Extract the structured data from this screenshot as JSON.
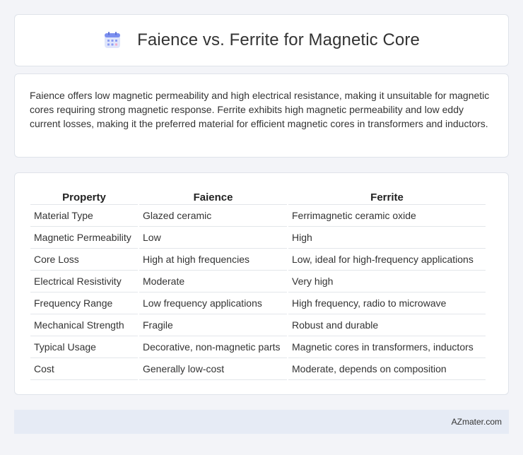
{
  "header": {
    "title": "Faience vs. Ferrite for Magnetic Core",
    "icon": "calendar-icon"
  },
  "summary": "Faience offers low magnetic permeability and high electrical resistance, making it unsuitable for magnetic cores requiring strong magnetic response. Ferrite exhibits high magnetic permeability and low eddy current losses, making it the preferred material for efficient magnetic cores in transformers and inductors.",
  "table": {
    "headers": [
      "Property",
      "Faience",
      "Ferrite"
    ],
    "rows": [
      [
        "Material Type",
        "Glazed ceramic",
        "Ferrimagnetic ceramic oxide"
      ],
      [
        "Magnetic Permeability",
        "Low",
        "High"
      ],
      [
        "Core Loss",
        "High at high frequencies",
        "Low, ideal for high-frequency applications"
      ],
      [
        "Electrical Resistivity",
        "Moderate",
        "Very high"
      ],
      [
        "Frequency Range",
        "Low frequency applications",
        "High frequency, radio to microwave"
      ],
      [
        "Mechanical Strength",
        "Fragile",
        "Robust and durable"
      ],
      [
        "Typical Usage",
        "Decorative, non-magnetic parts",
        "Magnetic cores in transformers, inductors"
      ],
      [
        "Cost",
        "Generally low-cost",
        "Moderate, depends on composition"
      ]
    ]
  },
  "footer": {
    "site": "AZmater.com"
  },
  "colors": {
    "background": "#f3f4f8",
    "footer_bg": "#e6ebf5",
    "icon_primary": "#7b8ff0",
    "icon_accent": "#f3a8c8"
  }
}
